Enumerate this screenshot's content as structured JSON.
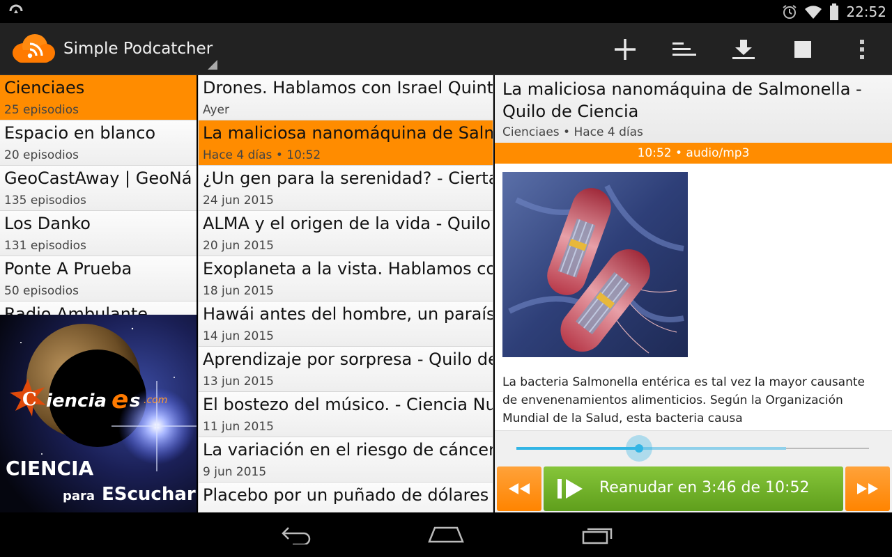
{
  "status_bar": {
    "time": "22:52",
    "icons": [
      "sync-icon",
      "alarm-icon",
      "wifi-icon",
      "battery-icon"
    ]
  },
  "action_bar": {
    "title": "Simple Podcatcher",
    "actions": [
      {
        "name": "add-podcast-button",
        "icon": "plus-icon"
      },
      {
        "name": "sort-button",
        "icon": "sort-icon"
      },
      {
        "name": "download-button",
        "icon": "download-icon"
      },
      {
        "name": "stop-button",
        "icon": "stop-icon"
      },
      {
        "name": "overflow-menu-button",
        "icon": "more-vert-icon"
      }
    ]
  },
  "podcasts": [
    {
      "title": "Cienciaes",
      "sub": "25 episodios",
      "selected": true
    },
    {
      "title": "Espacio en blanco",
      "sub": "20 episodios"
    },
    {
      "title": "GeoCastAway | GeoNá",
      "sub": "135 episodios"
    },
    {
      "title": "Los Danko",
      "sub": "131 episodios"
    },
    {
      "title": "Ponte A Prueba",
      "sub": "50 episodios"
    },
    {
      "title": "Radio Ambulante",
      "sub": ""
    }
  ],
  "cover": {
    "brand_c": "C",
    "brand_text": "iencia",
    "brand_e": "e",
    "brand_s": "s",
    "brand_com": ".com",
    "line1": "CIENCIA",
    "line2a": "para",
    "line2b": "EScuchar"
  },
  "episodes": [
    {
      "title": "Drones. Hablamos con Israel Quint",
      "sub": "Ayer"
    },
    {
      "title": "La maliciosa nanomáquina de Salmo",
      "sub": "Hace 4 días • 10:52",
      "selected": true
    },
    {
      "title": "¿Un gen para la serenidad? - Cierta",
      "sub": "24 jun 2015"
    },
    {
      "title": "ALMA y el origen de la vida - Quilo",
      "sub": "20 jun 2015"
    },
    {
      "title": "Exoplaneta a la vista. Hablamos co",
      "sub": "18 jun 2015"
    },
    {
      "title": "Hawái antes del hombre, un paraís",
      "sub": "14 jun 2015"
    },
    {
      "title": "Aprendizaje por sorpresa - Quilo de",
      "sub": "13 jun 2015"
    },
    {
      "title": "El bostezo del músico. - Ciencia Nu",
      "sub": "11 jun 2015"
    },
    {
      "title": "La variación en el riesgo de cáncer",
      "sub": "9 jun 2015"
    },
    {
      "title": "Placebo por un puñado de dólares",
      "sub": ""
    }
  ],
  "detail": {
    "title": "La maliciosa nanomáquina de Salmonella - Quilo de Ciencia",
    "sub": "Cienciaes • Hace 4 días",
    "bar": "10:52 • audio/mp3",
    "description": "La bacteria Salmonella entérica es tal vez la mayor causante de envenenamientos alimenticios. Según la Organización Mundial de la Salud, esta bacteria causa"
  },
  "player": {
    "resume_label": "Reanudar en 3:46 de 10:52",
    "played_fraction": 0.347,
    "buffered_fraction": 0.765,
    "accent_color": "#33b5e5"
  },
  "colors": {
    "selection": "#ff8c00",
    "play_button": "#6db22a"
  }
}
